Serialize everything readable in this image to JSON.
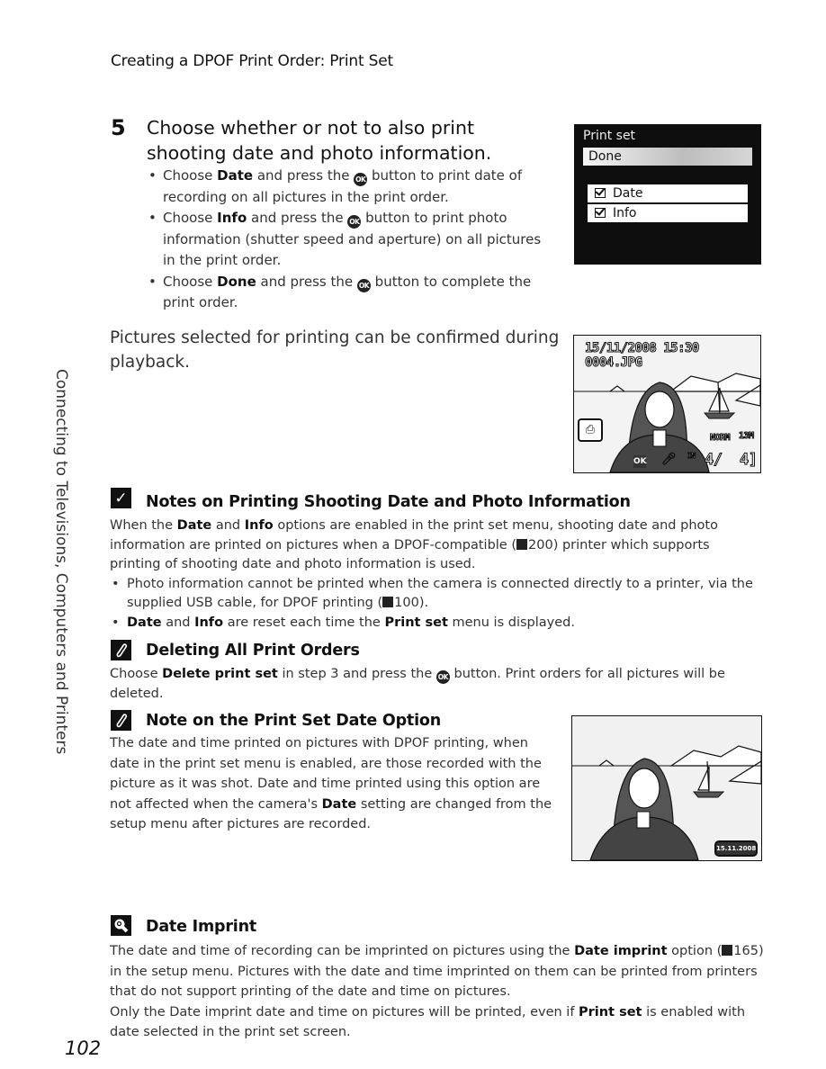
{
  "header": {
    "title": "Creating a DPOF Print Order: Print Set"
  },
  "side_tab": {
    "label": "Connecting to Televisions, Computers and Printers"
  },
  "step": {
    "number": "5",
    "title": "Choose whether or not to also print shooting date and photo information.",
    "bullets": [
      {
        "pre": "Choose ",
        "bold": "Date",
        "mid": " and press the ",
        "button": "OK",
        "post": " button to print date of recording on all pictures in the print order."
      },
      {
        "pre": "Choose ",
        "bold": "Info",
        "mid": " and press the ",
        "button": "OK",
        "post": " button to print photo information (shutter speed and aperture) on all pictures in the print order."
      },
      {
        "pre": "Choose ",
        "bold": "Done",
        "mid": " and press the ",
        "button": "OK",
        "post": " button to complete the print order."
      }
    ]
  },
  "confirm_text": "Pictures selected for printing can be confirmed during playback.",
  "camera_menu": {
    "title": "Print set",
    "selected": "Done",
    "options": [
      {
        "label": "Date",
        "checked": true
      },
      {
        "label": "Info",
        "checked": true
      }
    ]
  },
  "playback_screen": {
    "datetime": "15/11/2008 15:30",
    "filename": "0004.JPG",
    "quality": "NORM",
    "image_size": "13M",
    "frame": "4/",
    "total": "4]",
    "ok_label": "OK",
    "memory": "IN"
  },
  "notes": [
    {
      "icon": "check-icon",
      "title": "Notes on Printing Shooting Date and Photo Information",
      "p1_pre": "When the ",
      "p1_b1": "Date",
      "p1_mid": " and ",
      "p1_b2": "Info",
      "p1_post": " options are enabled in the print set menu, shooting date and photo information are printed on pictures when a DPOF-compatible (",
      "p1_ref": "200",
      "p1_end": ") printer which supports printing of shooting date and photo information is used.",
      "b1_text": "Photo information cannot be printed when the camera is connected directly to a printer, via the supplied USB cable, for DPOF printing (",
      "b1_ref": "100",
      "b1_end": ").",
      "b2_b1": "Date",
      "b2_mid": " and ",
      "b2_b2": "Info",
      "b2_post": " are reset each time the ",
      "b2_b3": "Print set",
      "b2_end": " menu is displayed."
    },
    {
      "icon": "paperclip-icon",
      "title": "Deleting All Print Orders",
      "pre": "Choose ",
      "bold": "Delete print set",
      "mid": " in step 3 and press the ",
      "button": "OK",
      "post": "  button. Print orders for all pictures will be deleted."
    },
    {
      "icon": "paperclip-icon",
      "title": "Note on the Print Set Date Option",
      "pre": "The date and time printed on pictures with DPOF printing, when date in the print set menu is enabled, are those recorded with the picture as it was shot. Date and time printed using this option are not affected when the camera's ",
      "bold": "Date",
      "post": " setting are changed from the setup menu after pictures are recorded.",
      "imprint_label": "15.11.2008"
    },
    {
      "icon": "lightbulb-icon",
      "title": "Date Imprint",
      "p1_pre": "The date and time of recording can be imprinted on pictures using the ",
      "p1_bold": "Date imprint",
      "p1_mid": " option (",
      "p1_ref": "165",
      "p1_post": ") in the setup menu. Pictures with the date and time imprinted on them can be printed from printers that do not support printing of the date and time on pictures.",
      "p2_pre": "Only the Date imprint date and time on pictures will be printed, even if ",
      "p2_bold": "Print set",
      "p2_post": " is enabled with date selected in the print set screen."
    }
  ],
  "page_number": "102"
}
